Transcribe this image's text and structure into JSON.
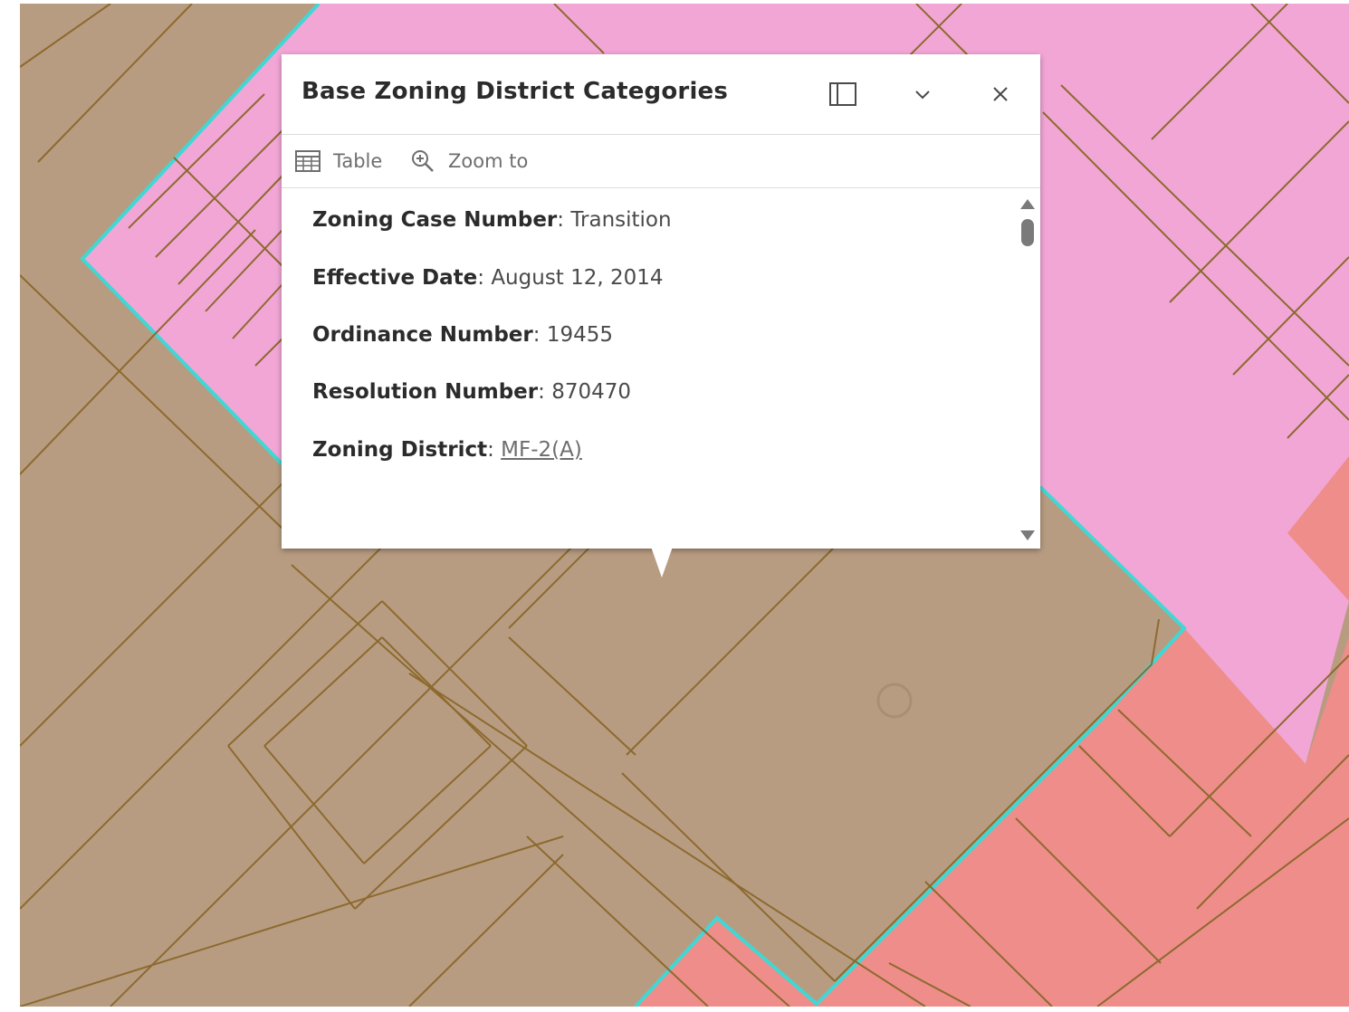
{
  "popup": {
    "title": "Base Zoning District Categories",
    "actions": {
      "table_label": "Table",
      "zoom_label": "Zoom to"
    },
    "fields": [
      {
        "label": "Zoning Case Number",
        "value": "Transition"
      },
      {
        "label": "Effective Date",
        "value": "August 12, 2014"
      },
      {
        "label": "Ordinance Number",
        "value": "19455"
      },
      {
        "label": "Resolution Number",
        "value": "870470"
      },
      {
        "label": "Zoning District",
        "value": "MF-2(A)"
      }
    ]
  },
  "map": {
    "colors": {
      "base_zone": "#b89c82",
      "parcel_line": "#8c6a2e",
      "pink_zone": "#f2a6d6",
      "red_zone": "#ef8d8a",
      "selection_outline": "#3fd8d4"
    }
  },
  "icons": {
    "dock": "dock-icon",
    "collapse": "chevron-down-icon",
    "close": "close-icon",
    "table": "table-icon",
    "zoom": "zoom-in-icon"
  }
}
